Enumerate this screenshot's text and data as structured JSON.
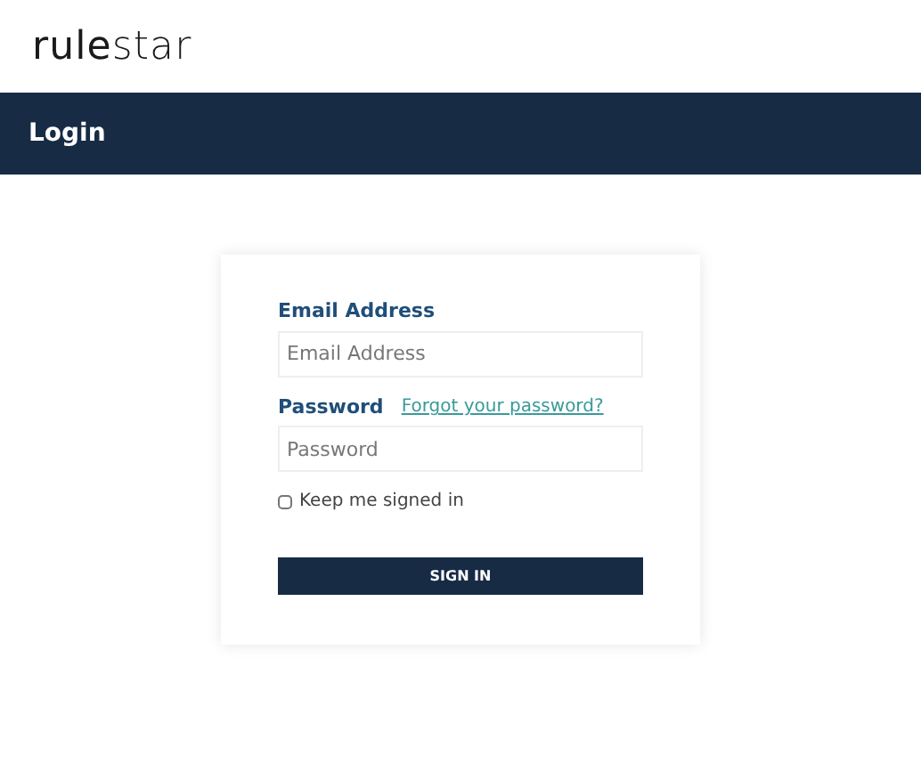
{
  "logo": "**rule**star",
  "banner": {
    "title": "Login"
  },
  "form": {
    "email": {
      "label": "Email Address",
      "placeholder": "Email Address"
    },
    "password": {
      "label": "Password",
      "placeholder": "Password",
      "forgot_link": "Forgot your password?"
    },
    "remember": {
      "label": "Keep me signed in",
      "checked": false
    },
    "submit": "SIGN IN"
  }
}
